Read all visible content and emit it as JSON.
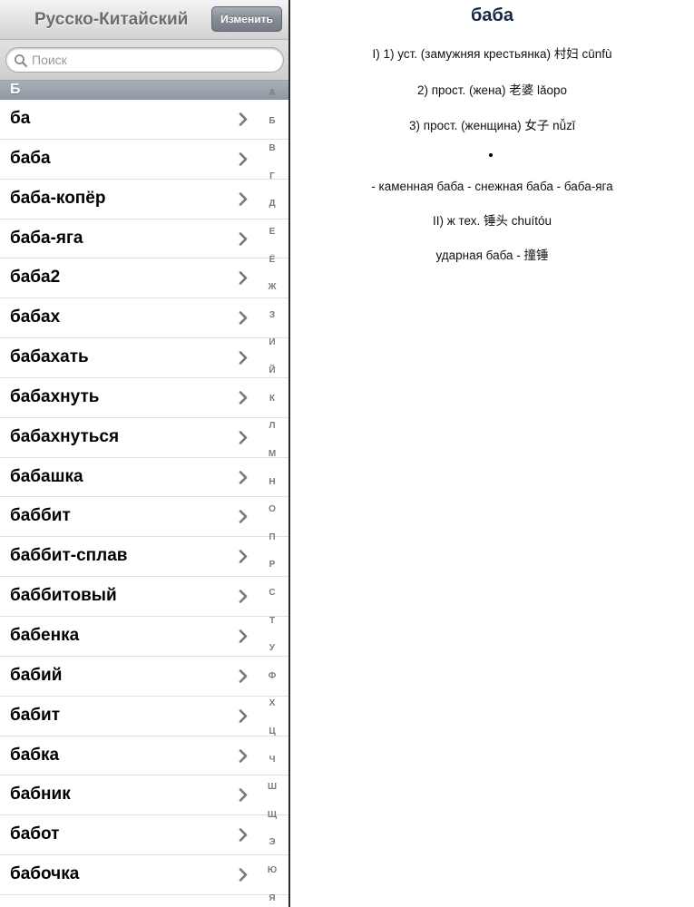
{
  "navbar": {
    "title": "Русско-Китайский",
    "edit_label": "Изменить"
  },
  "search": {
    "placeholder": "Поиск",
    "value": ""
  },
  "section": {
    "letter": "Б"
  },
  "words": [
    "ба",
    "баба",
    "баба-копёр",
    "баба-яга",
    "баба2",
    "бабах",
    "бабахать",
    "бабахнуть",
    "бабахнуться",
    "бабашка",
    "баббит",
    "баббит-сплав",
    "баббитовый",
    "бабенка",
    "бабий",
    "бабит",
    "бабка",
    "бабник",
    "бабот",
    "бабочка"
  ],
  "index_letters": [
    "А",
    "Б",
    "В",
    "Г",
    "Д",
    "Е",
    "Ё",
    "Ж",
    "З",
    "И",
    "Й",
    "К",
    "Л",
    "М",
    "Н",
    "О",
    "П",
    "Р",
    "С",
    "Т",
    "У",
    "Ф",
    "Х",
    "Ц",
    "Ч",
    "Ш",
    "Щ",
    "Э",
    "Ю",
    "Я"
  ],
  "entry": {
    "title": "баба",
    "lines": [
      "I) 1) уст. (замужняя крестьянка) 村妇 cūnfù",
      "2) прост. (жена) 老婆 lǎopo",
      "3) прост. (женщина) 女子 nǚzǐ",
      "- каменная баба - снежная баба - баба-яга",
      "II) ж тех. 锤头 chuítóu",
      "ударная баба - 撞锤"
    ]
  },
  "colors": {
    "navbar_title": "#6d6d6d",
    "entry_title": "#152741",
    "section_header": "#8d97a2",
    "chevron": "#777777"
  }
}
